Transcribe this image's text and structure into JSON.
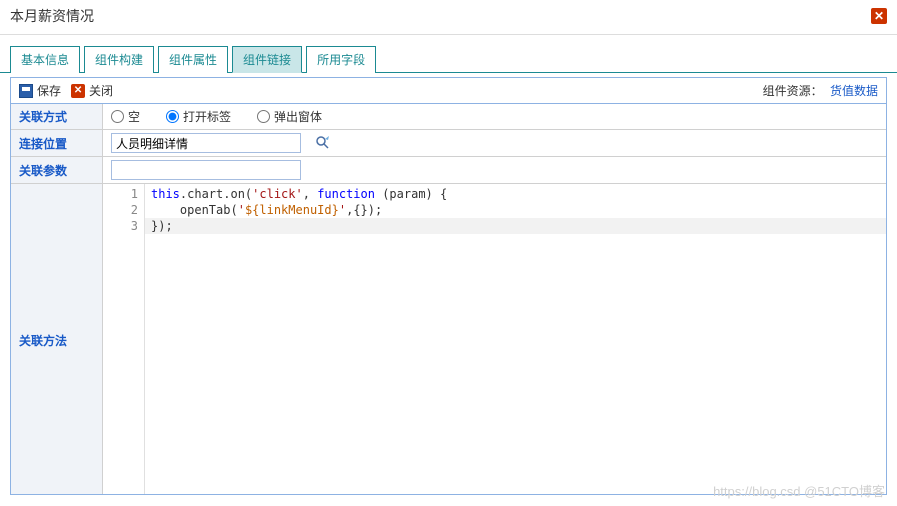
{
  "titlebar": {
    "title": "本月薪资情况"
  },
  "tabs": {
    "items": [
      {
        "label": "基本信息"
      },
      {
        "label": "组件构建"
      },
      {
        "label": "组件属性"
      },
      {
        "label": "组件链接"
      },
      {
        "label": "所用字段"
      }
    ],
    "active_index": 3
  },
  "toolbar": {
    "save_label": "保存",
    "close_label": "关闭",
    "resource_label": "组件资源：",
    "resource_link": "货值数据"
  },
  "form": {
    "assoc_mode": {
      "label": "关联方式",
      "options": [
        {
          "label": "空",
          "value": "none"
        },
        {
          "label": "打开标签",
          "value": "tab"
        },
        {
          "label": "弹出窗体",
          "value": "popup"
        }
      ],
      "selected": "tab"
    },
    "link_position": {
      "label": "连接位置",
      "value": "人员明细详情"
    },
    "assoc_params": {
      "label": "关联参数",
      "value": ""
    },
    "assoc_method": {
      "label": "关联方法",
      "code": {
        "lines": [
          {
            "n": 1,
            "segments": [
              {
                "t": "this",
                "c": "kw"
              },
              {
                "t": ".chart.on("
              },
              {
                "t": "'click'",
                "c": "str"
              },
              {
                "t": ", "
              },
              {
                "t": "function",
                "c": "kw"
              },
              {
                "t": " (param) {"
              }
            ]
          },
          {
            "n": 2,
            "segments": [
              {
                "t": "    openTab("
              },
              {
                "t": "'",
                "c": "str"
              },
              {
                "t": "${linkMenuId}",
                "c": "var"
              },
              {
                "t": "'",
                "c": "str"
              },
              {
                "t": ",{});"
              }
            ]
          },
          {
            "n": 3,
            "hl": true,
            "segments": [
              {
                "t": "});"
              }
            ]
          }
        ]
      }
    }
  },
  "watermark": "https://blog.csd @51CTO博客"
}
